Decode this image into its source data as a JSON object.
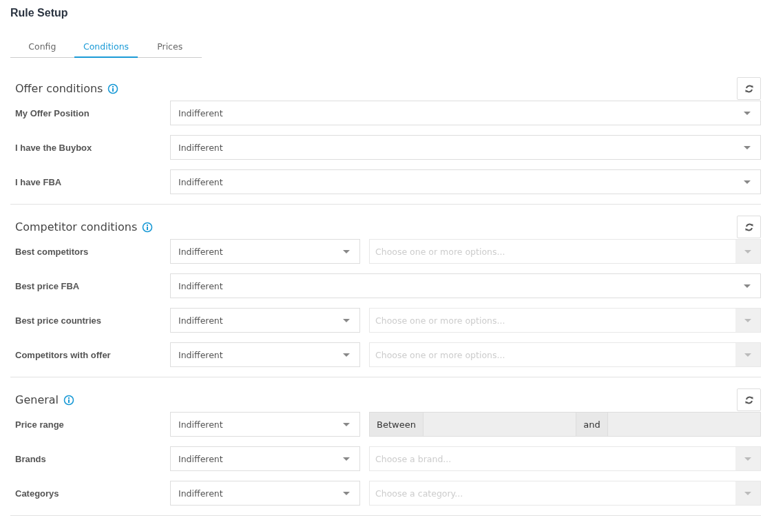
{
  "title": "Rule Setup",
  "tabs": [
    {
      "label": "Config",
      "selected": false
    },
    {
      "label": "Conditions",
      "selected": true
    },
    {
      "label": "Prices",
      "selected": false
    }
  ],
  "sections": [
    {
      "title": "Offer conditions",
      "rows": [
        {
          "label": "My Offer Position",
          "kind": "select",
          "value": "Indifferent"
        },
        {
          "label": "I have the Buybox",
          "kind": "select",
          "value": "Indifferent"
        },
        {
          "label": "I have FBA",
          "kind": "select",
          "value": "Indifferent"
        }
      ]
    },
    {
      "title": "Competitor conditions",
      "rows": [
        {
          "label": "Best competitors",
          "kind": "select_multi",
          "value": "Indifferent",
          "multi": {
            "placeholder": "Choose one or more options...",
            "disabled": true
          }
        },
        {
          "label": "Best price FBA",
          "kind": "select",
          "value": "Indifferent"
        },
        {
          "label": "Best price countries",
          "kind": "select_multi",
          "value": "Indifferent",
          "multi": {
            "placeholder": "Choose one or more options...",
            "disabled": true
          }
        },
        {
          "label": "Competitors with offer",
          "kind": "select_multi",
          "value": "Indifferent",
          "multi": {
            "placeholder": "Choose one or more options...",
            "disabled": true
          }
        }
      ]
    },
    {
      "title": "General",
      "rows": [
        {
          "label": "Price range",
          "kind": "select_range",
          "value": "Indifferent",
          "range": {
            "from_label": "Between",
            "to_label": "and",
            "disabled": true
          }
        },
        {
          "label": "Brands",
          "kind": "select_multi",
          "value": "Indifferent",
          "multi": {
            "placeholder": "Choose a brand...",
            "disabled": true
          }
        },
        {
          "label": "Categorys",
          "kind": "select_multi",
          "value": "Indifferent",
          "multi": {
            "placeholder": "Choose a category...",
            "disabled": true
          }
        }
      ]
    }
  ]
}
